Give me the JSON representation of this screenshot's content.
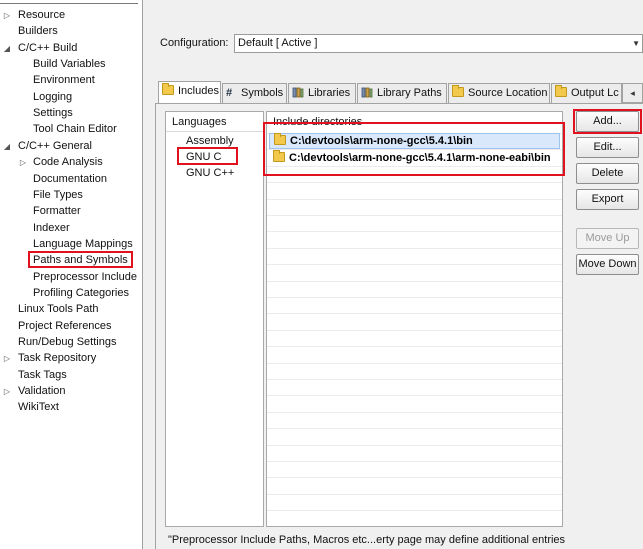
{
  "tree": {
    "items": [
      {
        "label": "Resource",
        "arrow": "▷"
      },
      {
        "label": "Builders",
        "arrow": ""
      },
      {
        "label": "C/C++ Build",
        "arrow": "◢"
      },
      {
        "label": "Build Variables",
        "arrow": ""
      },
      {
        "label": "Environment",
        "arrow": ""
      },
      {
        "label": "Logging",
        "arrow": ""
      },
      {
        "label": "Settings",
        "arrow": ""
      },
      {
        "label": "Tool Chain Editor",
        "arrow": ""
      },
      {
        "label": "C/C++ General",
        "arrow": "◢"
      },
      {
        "label": "Code Analysis",
        "arrow": "▷"
      },
      {
        "label": "Documentation",
        "arrow": ""
      },
      {
        "label": "File Types",
        "arrow": ""
      },
      {
        "label": "Formatter",
        "arrow": ""
      },
      {
        "label": "Indexer",
        "arrow": ""
      },
      {
        "label": "Language Mappings",
        "arrow": ""
      },
      {
        "label": "Paths and Symbols",
        "arrow": ""
      },
      {
        "label": "Preprocessor Include",
        "arrow": ""
      },
      {
        "label": "Profiling Categories",
        "arrow": ""
      },
      {
        "label": "Linux Tools Path",
        "arrow": ""
      },
      {
        "label": "Project References",
        "arrow": ""
      },
      {
        "label": "Run/Debug Settings",
        "arrow": ""
      },
      {
        "label": "Task Repository",
        "arrow": "▷"
      },
      {
        "label": "Task Tags",
        "arrow": ""
      },
      {
        "label": "Validation",
        "arrow": "▷"
      },
      {
        "label": "WikiText",
        "arrow": ""
      }
    ]
  },
  "configuration": {
    "label": "Configuration:",
    "value": "Default  [ Active ]",
    "dropdown_arrow": "▼"
  },
  "tabs": [
    {
      "label": "Includes",
      "icon": "folder-icon"
    },
    {
      "label": "Symbols",
      "icon": "hash-icon"
    },
    {
      "label": "Libraries",
      "icon": "library-icon"
    },
    {
      "label": "Library Paths",
      "icon": "library-icon"
    },
    {
      "label": "Source Location",
      "icon": "source-folder-icon"
    },
    {
      "label": "Output Lc",
      "icon": "output-folder-icon"
    }
  ],
  "tab_scroll": "◂",
  "languages": {
    "header": "Languages",
    "items": [
      "Assembly",
      "GNU C",
      "GNU C++"
    ]
  },
  "include_directories": {
    "header": "Include directories",
    "rows": [
      "C:\\devtools\\arm-none-gcc\\5.4.1\\bin",
      "C:\\devtools\\arm-none-gcc\\5.4.1\\arm-none-eabi\\bin"
    ]
  },
  "buttons": {
    "add": "Add...",
    "edit": "Edit...",
    "delete": "Delete",
    "export": "Export",
    "move_up": "Move Up",
    "move_down": "Move Down"
  },
  "footnote": "\"Preprocessor Include Paths, Macros etc...erty page may define additional entries",
  "highlight_color": "#e0121e"
}
